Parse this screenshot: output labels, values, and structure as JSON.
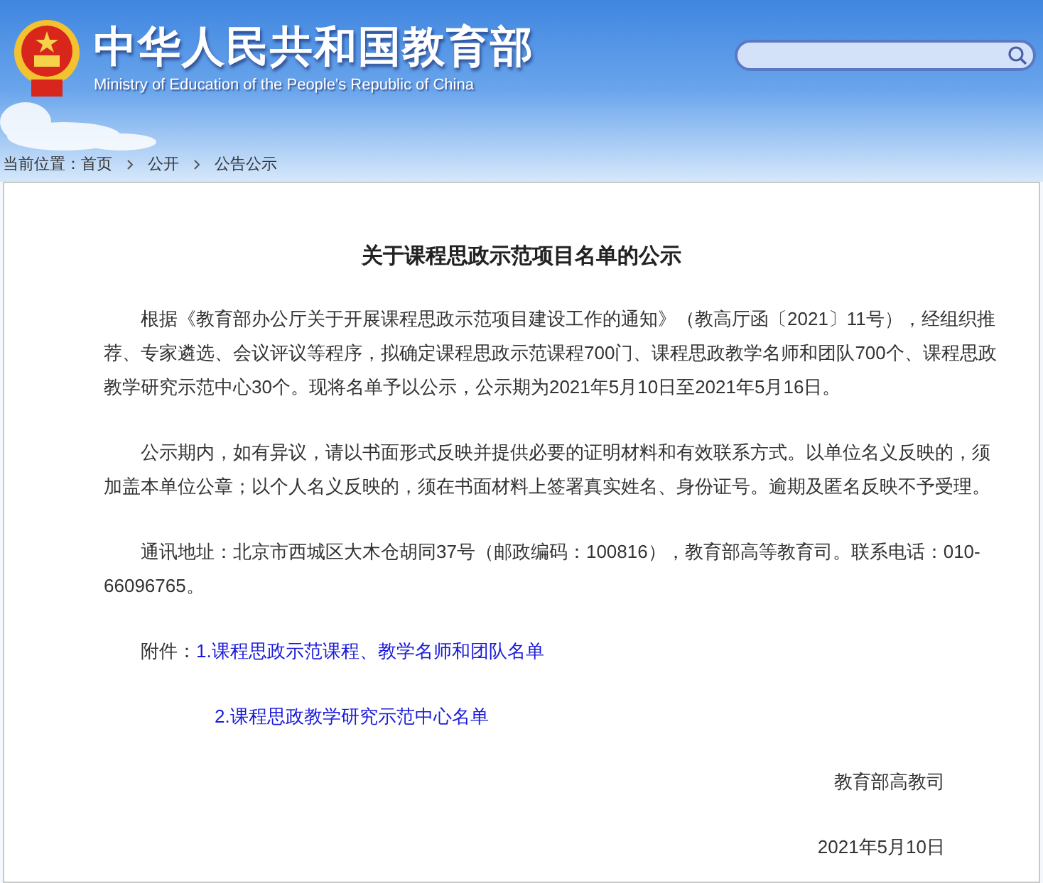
{
  "header": {
    "title": "中华人民共和国教育部",
    "subtitle": "Ministry of Education of the People's Republic of China"
  },
  "breadcrumb": {
    "label": "当前位置：",
    "items": [
      {
        "text": "首页"
      },
      {
        "text": "公开"
      },
      {
        "text": "公告公示"
      }
    ]
  },
  "article": {
    "title": "关于课程思政示范项目名单的公示",
    "paragraphs": [
      "根据《教育部办公厅关于开展课程思政示范项目建设工作的通知》（教高厅函〔2021〕11号），经组织推荐、专家遴选、会议评议等程序，拟确定课程思政示范课程700门、课程思政教学名师和团队700个、课程思政教学研究示范中心30个。现将名单予以公示，公示期为2021年5月10日至2021年5月16日。",
      "公示期内，如有异议，请以书面形式反映并提供必要的证明材料和有效联系方式。以单位名义反映的，须加盖本单位公章；以个人名义反映的，须在书面材料上签署真实姓名、身份证号。逾期及匿名反映不予受理。",
      "通讯地址：北京市西城区大木仓胡同37号（邮政编码：100816），教育部高等教育司。联系电话：010-66096765。"
    ],
    "attachments_label": "附件：",
    "attachments": [
      {
        "text": "1.课程思政示范课程、教学名师和团队名单"
      },
      {
        "text": "2.课程思政教学研究示范中心名单"
      }
    ],
    "signature": "教育部高教司",
    "date": "2021年5月10日"
  }
}
